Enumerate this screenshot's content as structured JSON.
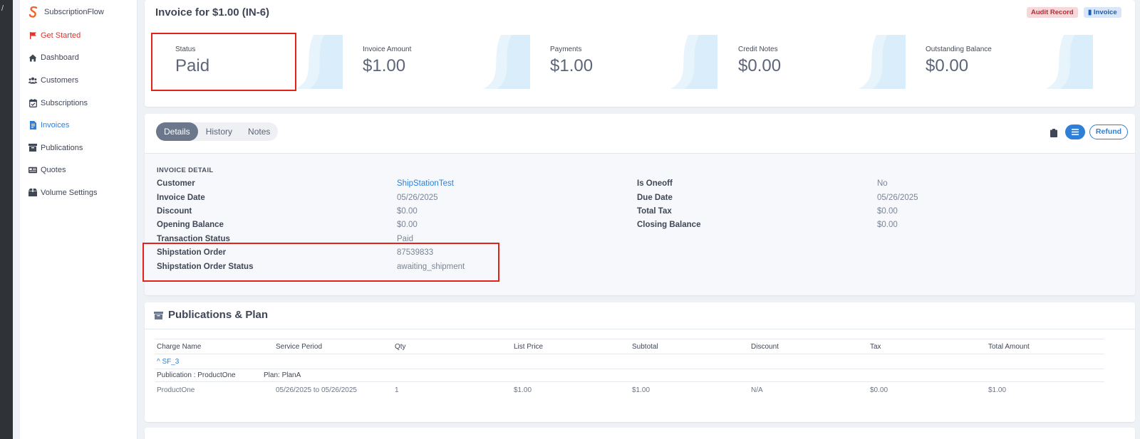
{
  "sidebar": {
    "brand": "SubscriptionFlow",
    "items": [
      {
        "label": "Get Started",
        "icon": "flag-icon"
      },
      {
        "label": "Dashboard",
        "icon": "home-icon"
      },
      {
        "label": "Customers",
        "icon": "users-icon"
      },
      {
        "label": "Subscriptions",
        "icon": "calendar-check-icon"
      },
      {
        "label": "Invoices",
        "icon": "file-invoice-icon"
      },
      {
        "label": "Publications",
        "icon": "archive-icon"
      },
      {
        "label": "Quotes",
        "icon": "id-card-icon"
      },
      {
        "label": "Volume Settings",
        "icon": "box-icon"
      }
    ]
  },
  "header": {
    "title": "Invoice for $1.00 (IN-6)",
    "badge_audit": "Audit Record",
    "badge_invoice": "Invoice"
  },
  "stats": [
    {
      "label": "Status",
      "value": "Paid"
    },
    {
      "label": "Invoice Amount",
      "value": "$1.00"
    },
    {
      "label": "Payments",
      "value": "$1.00"
    },
    {
      "label": "Credit Notes",
      "value": "$0.00"
    },
    {
      "label": "Outstanding Balance",
      "value": "$0.00"
    }
  ],
  "tabs": [
    "Details",
    "History",
    "Notes"
  ],
  "actions": {
    "refund": "Refund"
  },
  "detail": {
    "heading": "INVOICE DETAIL",
    "left": [
      {
        "label": "Customer",
        "value": "ShipStationTest"
      },
      {
        "label": "Invoice Date",
        "value": "05/26/2025"
      },
      {
        "label": "Discount",
        "value": "$0.00"
      },
      {
        "label": "Opening Balance",
        "value": "$0.00"
      },
      {
        "label": "Transaction Status",
        "value": "Paid"
      },
      {
        "label": "Shipstation Order",
        "value": "87539833"
      },
      {
        "label": "Shipstation Order Status",
        "value": "awaiting_shipment"
      }
    ],
    "right": [
      {
        "label": "Is Oneoff",
        "value": "No"
      },
      {
        "label": "Due Date",
        "value": "05/26/2025"
      },
      {
        "label": "Total Tax",
        "value": "$0.00"
      },
      {
        "label": "Closing Balance",
        "value": "$0.00"
      }
    ]
  },
  "publications": {
    "title": "Publications & Plan",
    "columns": [
      "Charge Name",
      "Service Period",
      "Qty",
      "List Price",
      "Subtotal",
      "Discount",
      "Tax",
      "Total Amount"
    ],
    "group": "^ SF_3",
    "publication_label": "Publication : ProductOne",
    "plan_label": "Plan: PlanA",
    "rows": [
      [
        "ProductOne",
        "05/26/2025 to 05/26/2025",
        "1",
        "$1.00",
        "$1.00",
        "N/A",
        "$0.00",
        "$1.00"
      ]
    ]
  },
  "colors": {
    "accent": "#2e7fd8",
    "highlight": "#e2231a",
    "get_started": "#e0322b"
  }
}
